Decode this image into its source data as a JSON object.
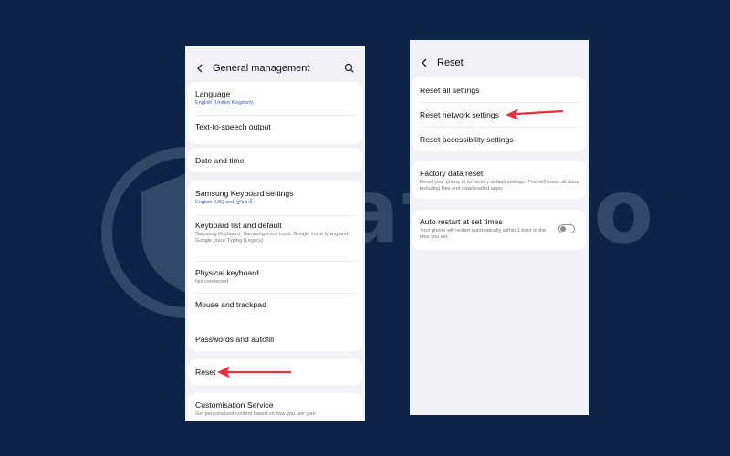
{
  "left_screen": {
    "title": "General management",
    "items": [
      {
        "title": "Language",
        "subtitle": "English (United Kingdom)"
      },
      {
        "title": "Text-to-speech output"
      },
      {
        "title": "Date and time"
      },
      {
        "title": "Samsung Keyboard settings",
        "subtitle": "English (US) and ગુજરાતી"
      },
      {
        "title": "Keyboard list and default",
        "subtitle": "Samsung Keyboard, Samsung voice input, Google voice typing and Google Voice Typing (Legacy)"
      },
      {
        "title": "Physical keyboard",
        "subtitle": "Not connected"
      },
      {
        "title": "Mouse and trackpad"
      },
      {
        "title": "Passwords and autofill"
      },
      {
        "title": "Reset"
      },
      {
        "title": "Customisation Service",
        "subtitle": "Get personalised content based on how you use your"
      }
    ]
  },
  "right_screen": {
    "title": "Reset",
    "items": [
      {
        "title": "Reset all settings"
      },
      {
        "title": "Reset network settings"
      },
      {
        "title": "Reset accessibility settings"
      },
      {
        "title": "Factory data reset",
        "subtitle": "Reset your phone to its factory default settings. This will erase all data, including files and downloaded apps."
      },
      {
        "title": "Auto restart at set times",
        "subtitle": "Your phone will restart automatically within 1 hour of the time you set.",
        "toggle_on": false
      }
    ]
  },
  "watermark": {
    "text": "Safelyo"
  },
  "colors": {
    "background": "#0d2447",
    "panel": "#f2f1f6",
    "card": "#ffffff",
    "arrow": "#e8303c",
    "subtitle_blue": "#3b5bbf"
  },
  "icons": [
    "back-arrow-icon",
    "search-icon",
    "red-arrow-annotation",
    "shield-logo-icon",
    "toggle-switch"
  ]
}
